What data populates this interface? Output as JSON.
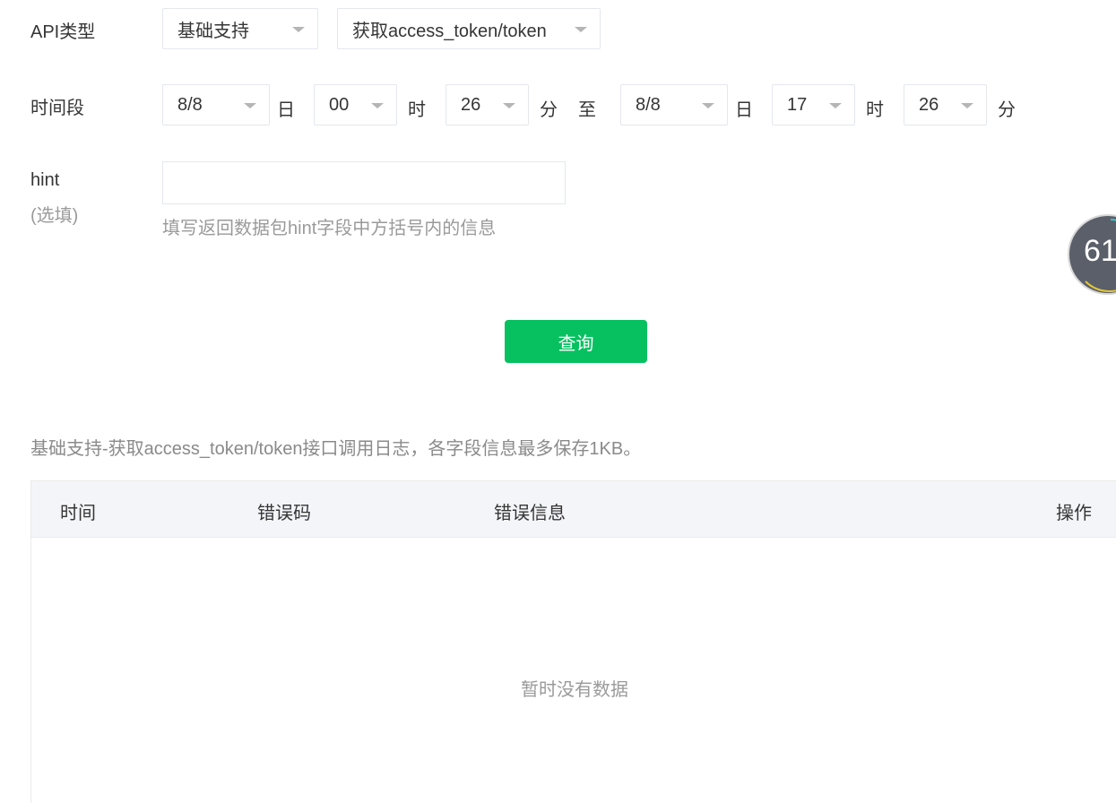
{
  "api_type": {
    "label": "API类型",
    "category_value": "基础支持",
    "endpoint_value": "获取access_token/token"
  },
  "time_range": {
    "label": "时间段",
    "start": {
      "date": "8/8",
      "day_unit": "日",
      "hour": "00",
      "hour_unit": "时",
      "minute": "26",
      "minute_unit": "分"
    },
    "to": "至",
    "end": {
      "date": "8/8",
      "day_unit": "日",
      "hour": "17",
      "hour_unit": "时",
      "minute": "26",
      "minute_unit": "分"
    }
  },
  "hint": {
    "label": "hint",
    "optional": "(选填)",
    "value": "",
    "help": "填写返回数据包hint字段中方括号内的信息"
  },
  "query_button": "查询",
  "log_description": "基础支持-获取access_token/token接口调用日志，各字段信息最多保存1KB。",
  "table": {
    "headers": [
      "时间",
      "错误码",
      "错误信息",
      "操作"
    ],
    "empty_text": "暂时没有数据"
  },
  "widget": {
    "value": "61"
  },
  "colors": {
    "primary_button": "#07c160",
    "header_bg": "#f4f5f9"
  }
}
